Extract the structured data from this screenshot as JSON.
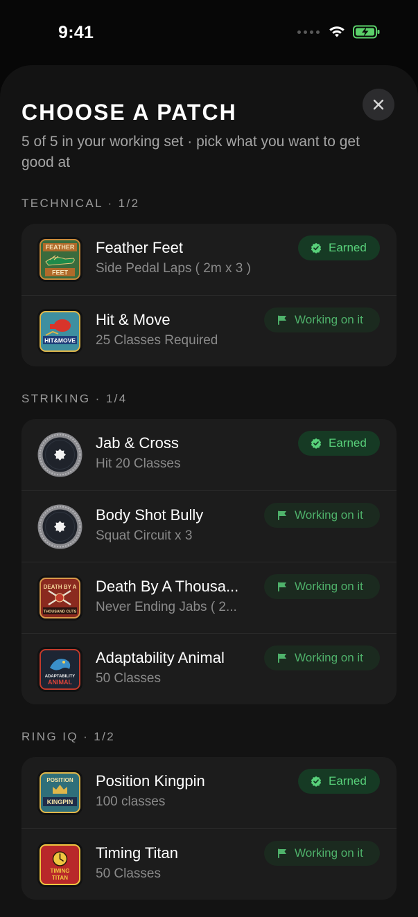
{
  "status_bar": {
    "time": "9:41"
  },
  "sheet": {
    "title": "CHOOSE A PATCH",
    "subtitle": "5 of 5 in your working set · pick what you want to get good at"
  },
  "sections": [
    {
      "label": "TECHNICAL · 1/2",
      "items": [
        {
          "title": "Feather Feet",
          "subtitle": "Side Pedal Laps ( 2m x 3 )",
          "badge": "Earned",
          "badge_state": "earned",
          "thumb": "feather-feet-patch-icon"
        },
        {
          "title": "Hit & Move",
          "subtitle": "25 Classes Required",
          "badge": "Working on it",
          "badge_state": "working",
          "thumb": "hit-and-move-patch-icon"
        }
      ]
    },
    {
      "label": "STRIKING · 1/4",
      "items": [
        {
          "title": "Jab & Cross",
          "subtitle": "Hit 20 Classes",
          "badge": "Earned",
          "badge_state": "earned",
          "thumb": "placeholder-patch-icon"
        },
        {
          "title": "Body Shot Bully",
          "subtitle": "Squat Circuit x 3",
          "badge": "Working on it",
          "badge_state": "working",
          "thumb": "placeholder-patch-icon"
        },
        {
          "title": "Death By A Thousa...",
          "subtitle": "Never Ending Jabs ( 2...",
          "badge": "Working on it",
          "badge_state": "working",
          "thumb": "death-by-a-thousand-cuts-patch-icon"
        },
        {
          "title": "Adaptability Animal",
          "subtitle": "50 Classes",
          "badge": "Working on it",
          "badge_state": "working",
          "thumb": "adaptability-animal-patch-icon"
        }
      ]
    },
    {
      "label": "RING IQ · 1/2",
      "items": [
        {
          "title": "Position Kingpin",
          "subtitle": "100 classes",
          "badge": "Earned",
          "badge_state": "earned",
          "thumb": "position-kingpin-patch-icon"
        },
        {
          "title": "Timing Titan",
          "subtitle": "50 Classes",
          "badge": "Working on it",
          "badge_state": "working",
          "thumb": "timing-titan-patch-icon"
        }
      ]
    }
  ],
  "patch_text": {
    "feather_feet": [
      "FEATHER",
      "FEET"
    ],
    "hit_and_move": "HIT&MOVE",
    "death": [
      "DEATH BY A",
      "THOUSAND CUTS"
    ],
    "adaptability": [
      "ADAPTABILITY",
      "ANIMAL"
    ],
    "position": [
      "POSITION",
      "KINGPIN"
    ],
    "timing": [
      "TIMING",
      "TITAN"
    ]
  },
  "colors": {
    "earned_badge_bg": "#163a24",
    "earned_badge_text": "#58d07a",
    "working_badge_bg": "#1b2a1f",
    "working_badge_text": "#4fb26b",
    "battery": "#5bd06a"
  }
}
